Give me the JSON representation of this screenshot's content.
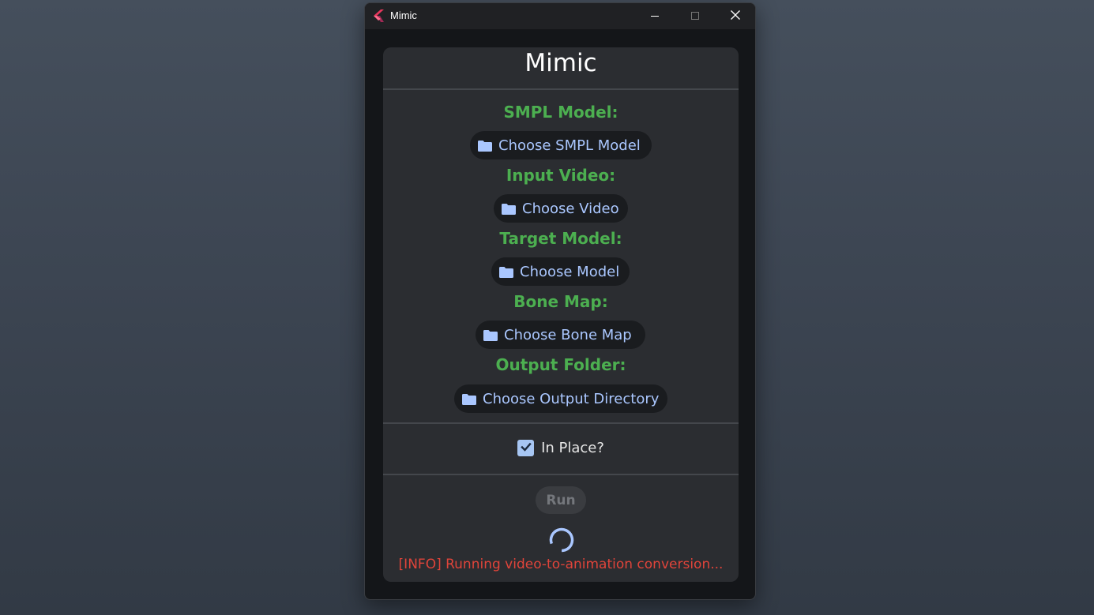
{
  "window": {
    "title": "Mimic",
    "controls": {
      "minimize": "minimize-icon",
      "maximize": "maximize-icon",
      "close": "close-icon"
    }
  },
  "card": {
    "title": "Mimic",
    "fields": [
      {
        "label": "SMPL Model:",
        "button": "Choose SMPL Model"
      },
      {
        "label": "Input Video:",
        "button": "Choose Video"
      },
      {
        "label": "Target Model:",
        "button": "Choose Model"
      },
      {
        "label": "Bone Map:",
        "button": "Choose Bone Map"
      },
      {
        "label": "Output Folder:",
        "button": "Choose Output Directory"
      }
    ],
    "in_place": {
      "label": "In Place?",
      "checked": true
    },
    "run_label": "Run",
    "status": "[INFO] Running video-to-animation conversion..."
  },
  "colors": {
    "label_green": "#4caf50",
    "button_text": "#aac7ff",
    "status_red": "#e0443a",
    "checkbox": "#a7c6f3"
  }
}
